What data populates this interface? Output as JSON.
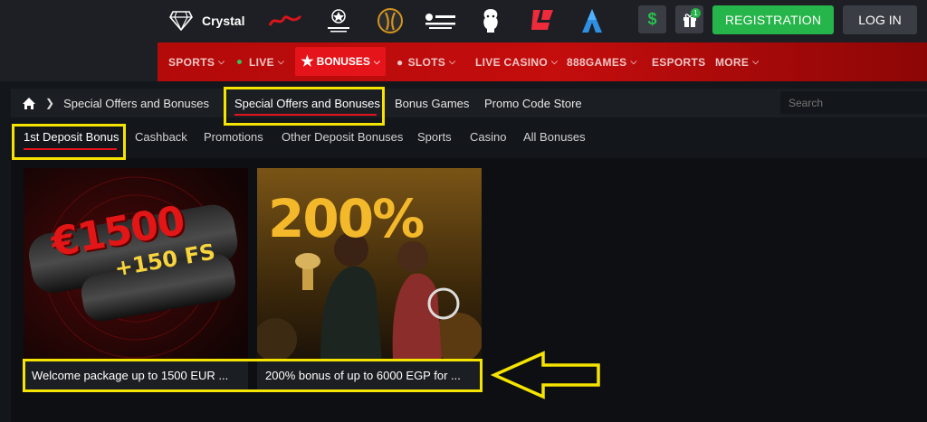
{
  "header": {
    "brand_name": "Crystal",
    "logos": [
      "diamond-logo",
      "seria-logo",
      "champions-league-logo",
      "europa-league-logo",
      "club-logo",
      "premier-league-logo",
      "laliga-logo",
      "serie-a-logo"
    ],
    "wallet_icon": "dollar-icon",
    "gift_badge": "1",
    "registration_label": "REGISTRATION",
    "login_label": "LOG IN"
  },
  "nav": {
    "items": [
      {
        "label": "SPORTS"
      },
      {
        "label": "LIVE"
      },
      {
        "label": "BONUSES"
      },
      {
        "label": "SLOTS"
      },
      {
        "label": "LIVE CASINO"
      },
      {
        "label": "888GAMES"
      },
      {
        "label": "ESPORTS"
      },
      {
        "label": "MORE"
      }
    ]
  },
  "breadcrumb": {
    "current": "Special Offers and Bonuses"
  },
  "subnav": {
    "tabs": [
      {
        "label": "Special Offers and Bonuses",
        "active": true
      },
      {
        "label": "Bonus Games"
      },
      {
        "label": "Promo Code Store"
      }
    ],
    "search_placeholder": "Search"
  },
  "filters": {
    "tabs": [
      {
        "label": "1st Deposit Bonus",
        "active": true
      },
      {
        "label": "Cashback"
      },
      {
        "label": "Promotions"
      },
      {
        "label": "Other Deposit Bonuses"
      },
      {
        "label": "Sports"
      },
      {
        "label": "Casino"
      },
      {
        "label": "All Bonuses"
      }
    ]
  },
  "cards": [
    {
      "image_text_1": "€1500",
      "image_text_2": "+150 FS",
      "caption": "Welcome package up to 1500 EUR ..."
    },
    {
      "image_text_1": "200%",
      "caption": "200% bonus of up to 6000 EGP for ..."
    }
  ],
  "colors": {
    "accent_red": "#e5141b",
    "green": "#26b54a",
    "highlight_yellow": "#f5e301"
  }
}
